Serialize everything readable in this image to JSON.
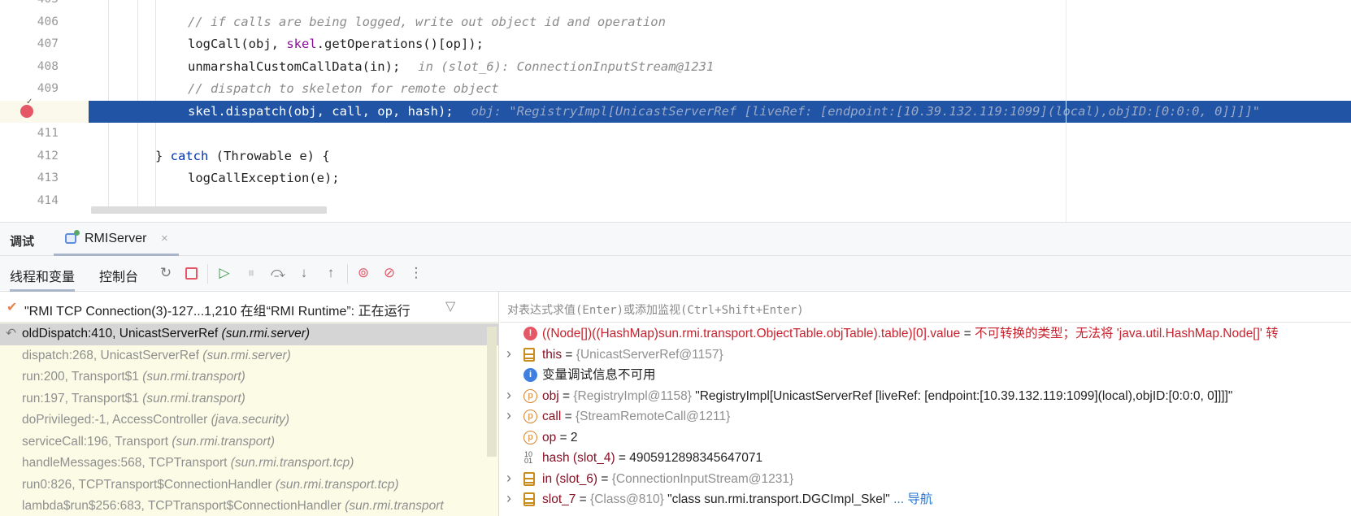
{
  "editor": {
    "lines": [
      {
        "no": "405",
        "parts": []
      },
      {
        "no": "406",
        "indent": 2,
        "parts": [
          {
            "t": "// if calls are being logged, write out object id and operation",
            "c": "cm"
          }
        ]
      },
      {
        "no": "407",
        "indent": 2,
        "parts": [
          {
            "t": "logCall(obj, "
          },
          {
            "t": "skel",
            "c": "fld"
          },
          {
            "t": ".getOperations()[op]);"
          }
        ]
      },
      {
        "no": "408",
        "indent": 2,
        "parts": [
          {
            "t": "unmarshalCustomCallData(in);"
          },
          {
            "t": "in (slot_6): ConnectionInputStream@1231",
            "c": "inl"
          }
        ]
      },
      {
        "no": "409",
        "indent": 2,
        "parts": [
          {
            "t": "// dispatch to skeleton for remote object",
            "c": "cm"
          }
        ]
      },
      {
        "no": "410",
        "indent": 2,
        "current": true,
        "breakpoint": true,
        "parts": [
          {
            "t": "skel.dispatch(obj, call, op, hash);"
          },
          {
            "t": "obj: \"RegistryImpl[UnicastServerRef [liveRef: [endpoint:[10.39.132.119:1099](local),objID:[0:0:0, 0]]]]\"",
            "c": "inl"
          }
        ]
      },
      {
        "no": "411",
        "indent": 2,
        "parts": []
      },
      {
        "no": "412",
        "indent": 1,
        "parts": [
          {
            "t": "} "
          },
          {
            "t": "catch",
            "c": "kw"
          },
          {
            "t": " (Throwable e) {"
          }
        ]
      },
      {
        "no": "413",
        "indent": 2,
        "parts": [
          {
            "t": "logCallException(e);"
          }
        ]
      },
      {
        "no": "414",
        "indent": 2,
        "parts": []
      }
    ]
  },
  "debug": {
    "title": "调试",
    "tab": {
      "label": "RMIServer",
      "close": "×"
    },
    "subtabs": [
      "线程和变量",
      "控制台"
    ],
    "toolbar_icons": [
      "rerun-icon",
      "stop-icon",
      "resume-icon",
      "pause-icon",
      "step-over-icon",
      "step-into-icon",
      "step-out-icon",
      "view-breakpoints-icon",
      "mute-breakpoints-icon",
      "more-icon"
    ]
  },
  "thread": {
    "label": "\"RMI TCP Connection(3)-127...1,210 在组“RMI Runtime”: 正在运行"
  },
  "frames": [
    {
      "method": "oldDispatch:410, UnicastServerRef",
      "pkg": "(sun.rmi.server)",
      "selected": true
    },
    {
      "method": "dispatch:268, UnicastServerRef",
      "pkg": "(sun.rmi.server)"
    },
    {
      "method": "run:200, Transport$1",
      "pkg": "(sun.rmi.transport)"
    },
    {
      "method": "run:197, Transport$1",
      "pkg": "(sun.rmi.transport)"
    },
    {
      "method": "doPrivileged:-1, AccessController",
      "pkg": "(java.security)"
    },
    {
      "method": "serviceCall:196, Transport",
      "pkg": "(sun.rmi.transport)"
    },
    {
      "method": "handleMessages:568, TCPTransport",
      "pkg": "(sun.rmi.transport.tcp)"
    },
    {
      "method": "run0:826, TCPTransport$ConnectionHandler",
      "pkg": "(sun.rmi.transport.tcp)"
    },
    {
      "method": "lambda$run$256:683, TCPTransport$ConnectionHandler",
      "pkg": "(sun.rmi.transport"
    }
  ],
  "eval": {
    "placeholder": "对表达式求值(Enter)或添加监视(Ctrl+Shift+Enter)"
  },
  "variables": [
    {
      "icon": "err",
      "expand": false,
      "name": "((Node[])((HashMap)sun.rmi.transport.ObjectTable.objTable).table)[0].value",
      "nameColor": "vr",
      "eq": " = ",
      "type": "",
      "value": "不可转换的类型；无法将 'java.util.HashMap.Node[]' 转",
      "valueColor": "vr"
    },
    {
      "icon": "fld",
      "expand": true,
      "name": "this",
      "eq": " = ",
      "type": "{UnicastServerRef@1157}",
      "value": ""
    },
    {
      "icon": "info",
      "expand": false,
      "name": "变量调试信息不可用",
      "nameColor": "plain",
      "eq": "",
      "type": "",
      "value": ""
    },
    {
      "icon": "p",
      "expand": true,
      "name": "obj",
      "eq": " = ",
      "type": "{RegistryImpl@1158}",
      "value": " \"RegistryImpl[UnicastServerRef [liveRef: [endpoint:[10.39.132.119:1099](local),objID:[0:0:0, 0]]]]\""
    },
    {
      "icon": "p",
      "expand": true,
      "name": "call",
      "eq": " = ",
      "type": "{StreamRemoteCall@1211}",
      "value": ""
    },
    {
      "icon": "p",
      "expand": false,
      "name": "op",
      "eq": " = ",
      "type": "",
      "value": "2"
    },
    {
      "icon": "bin",
      "expand": false,
      "name": "hash (slot_4)",
      "eq": " = ",
      "type": "",
      "value": "4905912898345647071"
    },
    {
      "icon": "fld",
      "expand": true,
      "name": "in (slot_6)",
      "eq": " = ",
      "type": "{ConnectionInputStream@1231}",
      "value": ""
    },
    {
      "icon": "fld",
      "expand": true,
      "name": "slot_7",
      "eq": " = ",
      "type": "{Class@810}",
      "value": " \"class sun.rmi.transport.DGCImpl_Skel\"",
      "link": " ... 导航"
    }
  ],
  "colors": {
    "current_line": "#2154a5",
    "breakpoint": "#e55765",
    "frames_bg": "#fbfbe6",
    "keyword": "#0033b3",
    "field": "#871094"
  }
}
